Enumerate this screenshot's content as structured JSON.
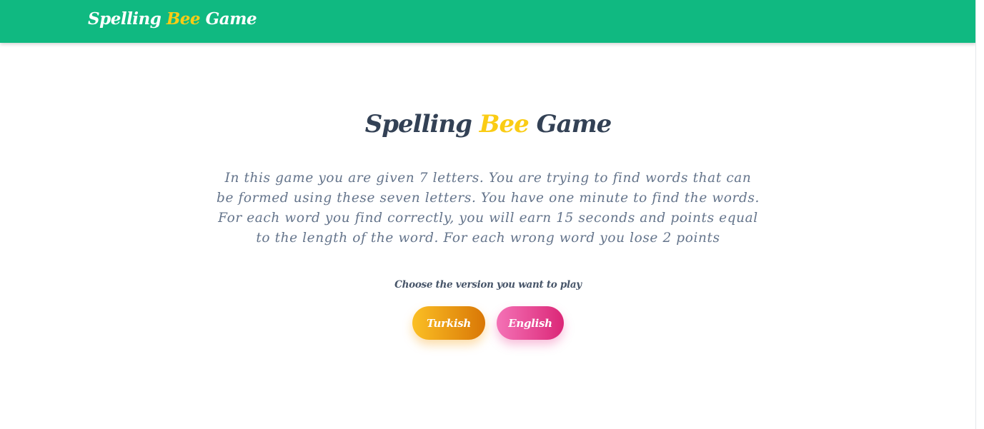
{
  "navbar": {
    "brand": {
      "part1": "Spelling ",
      "part2": "Bee",
      "part3": " Game"
    }
  },
  "main": {
    "title": {
      "part1": "Spelling ",
      "part2": "Bee",
      "part3": " Game"
    },
    "description": "In this game you are given 7 letters. You are trying to find words that can be formed using these seven letters. You have one minute to find the words. For each word you find correctly, you will earn 15 seconds and points equal to the length of the word. For each wrong word you lose 2 points",
    "choose_prompt": "Choose the version you want to play",
    "buttons": {
      "turkish": "Turkish",
      "english": "English"
    }
  },
  "colors": {
    "navbar_bg": "#10b981",
    "accent_yellow": "#facc15",
    "title_text": "#334155",
    "body_text": "#64748b",
    "turkish_gradient": [
      "#fbbf24",
      "#d97706"
    ],
    "english_gradient": [
      "#f472b6",
      "#db2777"
    ]
  }
}
